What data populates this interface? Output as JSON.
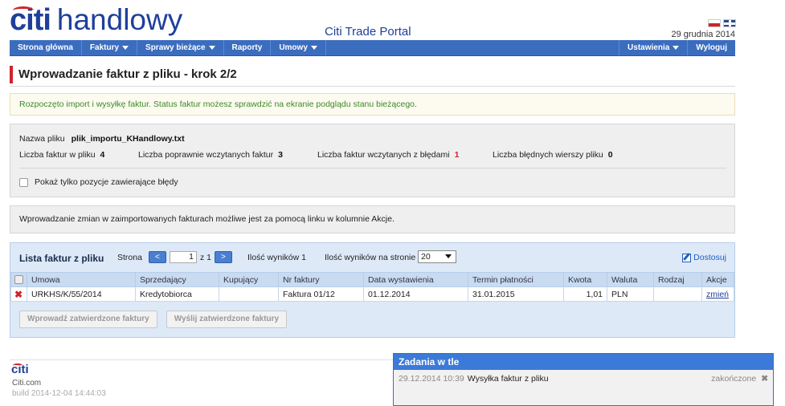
{
  "header": {
    "brand_citi": "citi",
    "brand_name": "handlowy",
    "portal_title": "Citi Trade Portal",
    "date": "29 grudnia 2014"
  },
  "nav": {
    "items": [
      {
        "label": "Strona główna",
        "dropdown": false
      },
      {
        "label": "Faktury",
        "dropdown": true
      },
      {
        "label": "Sprawy bieżące",
        "dropdown": true
      },
      {
        "label": "Raporty",
        "dropdown": false
      },
      {
        "label": "Umowy",
        "dropdown": true
      }
    ],
    "right_items": [
      {
        "label": "Ustawienia",
        "dropdown": true
      },
      {
        "label": "Wyloguj",
        "dropdown": false
      }
    ]
  },
  "page": {
    "title": "Wprowadzanie faktur z pliku - krok 2/2",
    "success_message": "Rozpoczęto import i wysyłkę faktur. Status faktur możesz sprawdzić na ekranie podglądu stanu bieżącego.",
    "notice": "Wprowadzanie zmian w zaimportowanych fakturach możliwe jest za pomocą linku w kolumnie Akcje."
  },
  "file_info": {
    "name_label": "Nazwa pliku",
    "name_value": "plik_importu_KHandlowy.txt",
    "stats": [
      {
        "label": "Liczba faktur w pliku",
        "value": "4"
      },
      {
        "label": "Liczba poprawnie wczytanych faktur",
        "value": "3"
      },
      {
        "label": "Liczba faktur wczytanych z błędami",
        "value": "1"
      },
      {
        "label": "Liczba błędnych wierszy pliku",
        "value": "0"
      }
    ],
    "errors_only_label": "Pokaż tylko pozycje zawierające błędy"
  },
  "list": {
    "title": "Lista faktur z pliku",
    "page_label": "Strona",
    "prev": "<",
    "next": ">",
    "page_value": "1",
    "page_of": "z 1",
    "results_count": "Ilość wyników 1",
    "per_page_label": "Ilość wyników na stronie",
    "per_page_value": "20",
    "customize": "Dostosuj",
    "columns": [
      "Umowa",
      "Sprzedający",
      "Kupujący",
      "Nr faktury",
      "Data wystawienia",
      "Termin płatności",
      "Kwota",
      "Waluta",
      "Rodzaj",
      "Akcje"
    ],
    "rows": [
      {
        "umowa": "URKHS/K/55/2014",
        "sprzedajacy": "Kredytobiorca",
        "kupujacy": "",
        "nr": "Faktura 01/12",
        "data": "01.12.2014",
        "termin": "31.01.2015",
        "kwota": "1,01",
        "waluta": "PLN",
        "rodzaj": "",
        "akcja": "zmień"
      }
    ],
    "btn_submit": "Wprowadź zatwierdzone faktury",
    "btn_send": "Wyślij zatwierdzone faktury"
  },
  "footer": {
    "logo": "citi",
    "link": "Citi.com",
    "build": "build 2014-12-04 14:44:03"
  },
  "tasks": {
    "title": "Zadania w tle",
    "row": {
      "time": "29.12.2014 10:39",
      "name": "Wysyłka faktur z pliku",
      "status": "zakończone"
    }
  },
  "colors": {
    "nav": "#3b6dbf",
    "brand": "#1f3f9b",
    "accent_red": "#d0232a",
    "success_text": "#3a8a27"
  }
}
